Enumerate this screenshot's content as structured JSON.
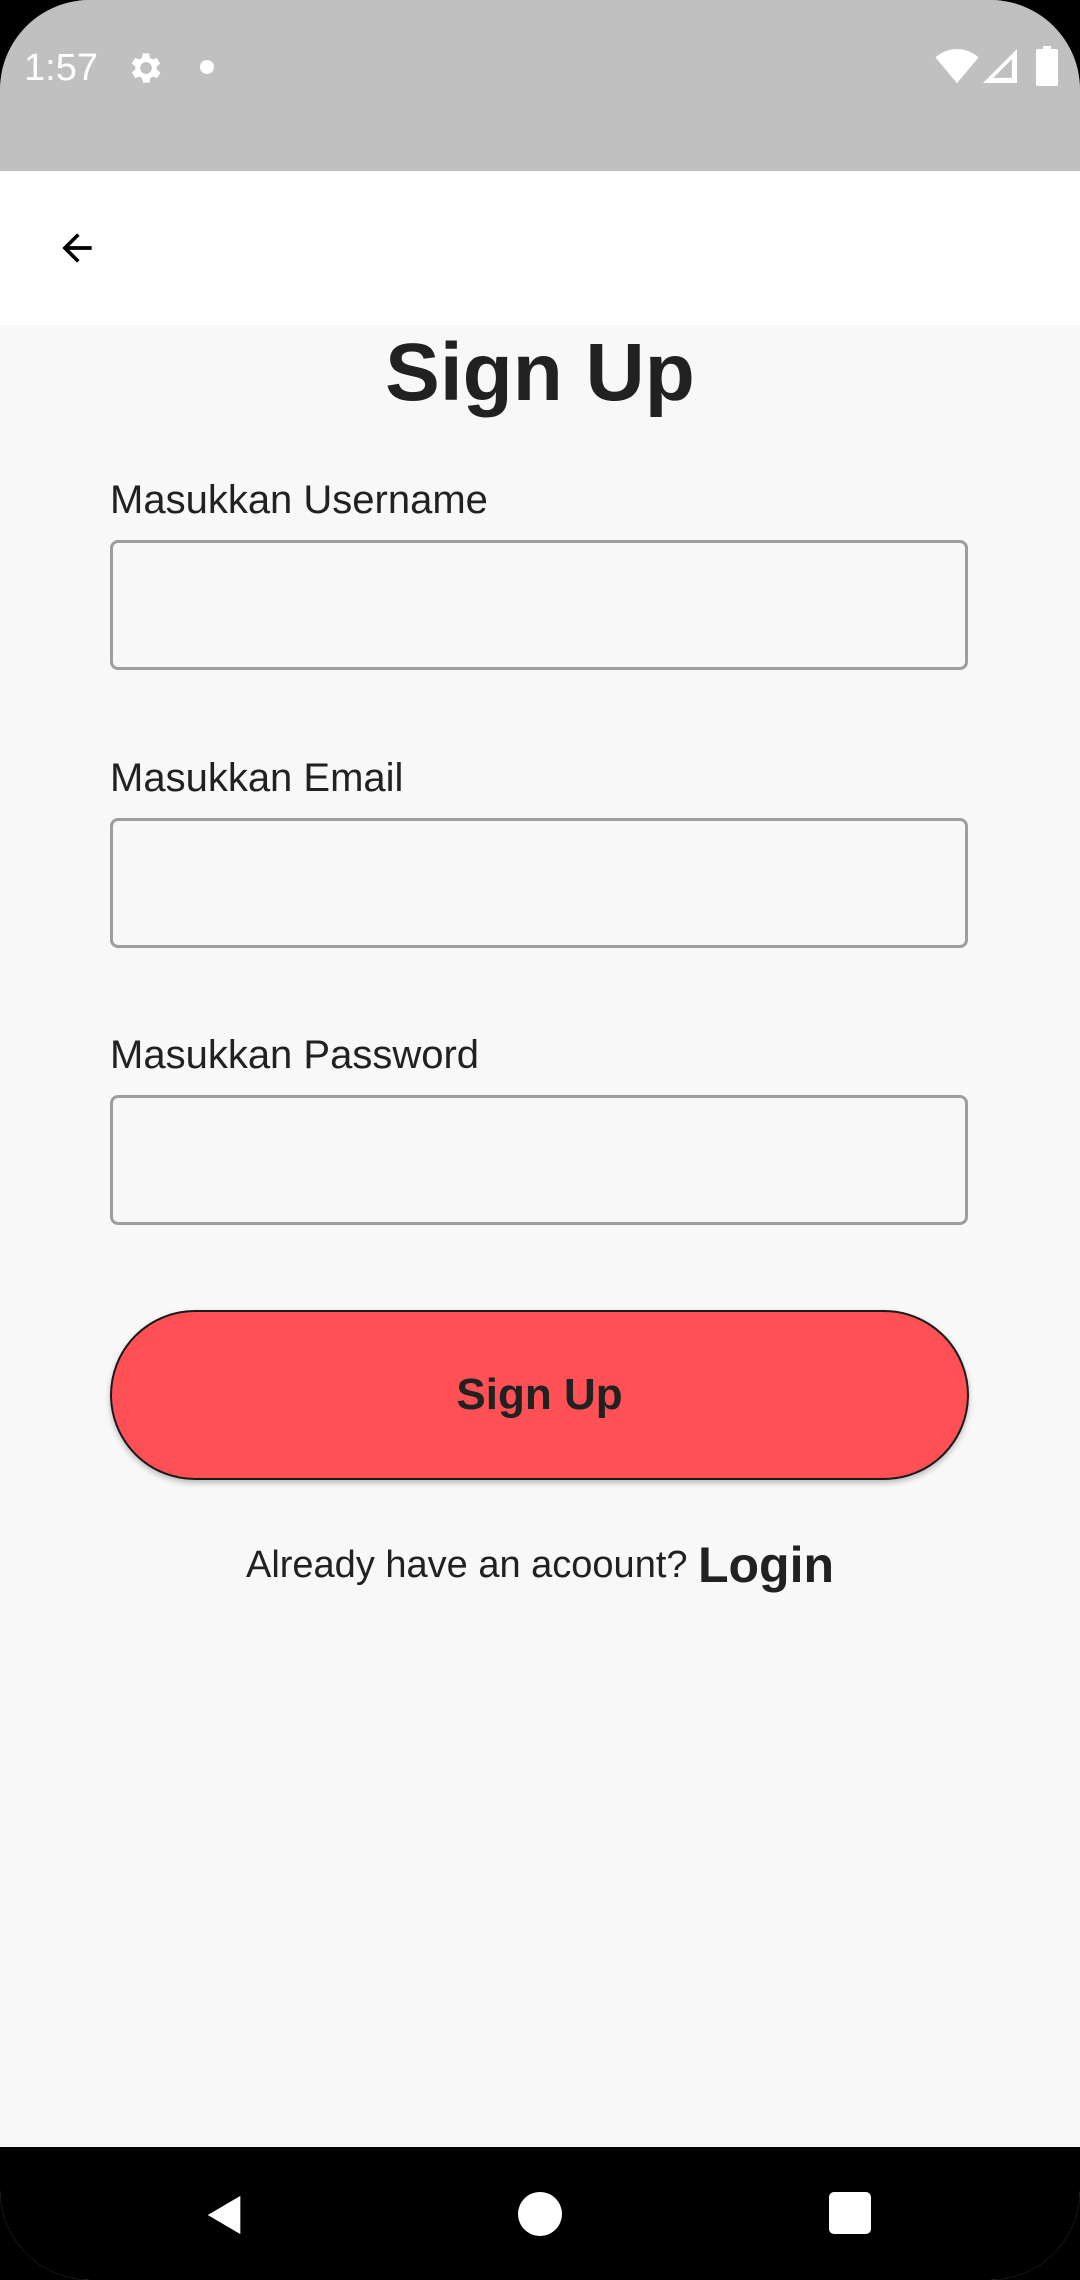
{
  "status_bar": {
    "time": "1:57",
    "icons": [
      "gear-icon",
      "notification-dot-icon",
      "wifi-icon",
      "signal-icon",
      "battery-icon"
    ]
  },
  "app_bar": {
    "back_icon": "arrow-left-icon"
  },
  "page": {
    "title": "Sign Up"
  },
  "form": {
    "username": {
      "label": "Masukkan Username",
      "value": ""
    },
    "email": {
      "label": "Masukkan Email",
      "value": ""
    },
    "password": {
      "label": "Masukkan Password",
      "value": ""
    },
    "submit_label": "Sign Up"
  },
  "login_prompt": {
    "text": "Already have an acoount?",
    "link": "Login"
  },
  "nav_bar": {
    "icons": [
      "back-triangle-icon",
      "home-circle-icon",
      "recents-square-icon"
    ]
  },
  "colors": {
    "status_bar": "#c0c0c0",
    "background": "#f8f8f8",
    "app_bar": "#ffffff",
    "accent_button": "#fe5055",
    "text": "#212121"
  }
}
